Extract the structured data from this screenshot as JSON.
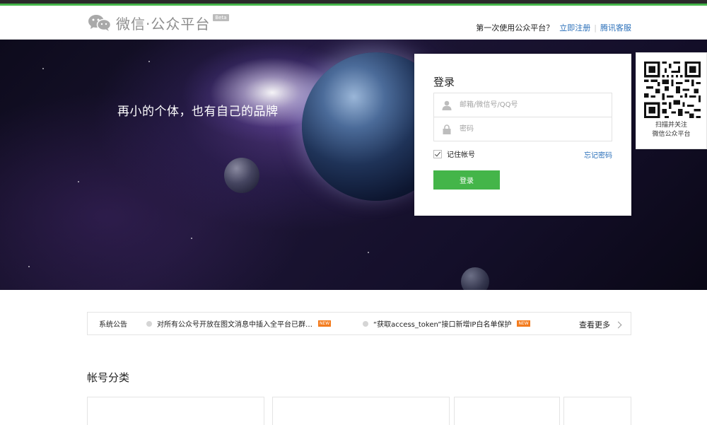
{
  "header": {
    "logo_text": "微信·公众平台",
    "logo_badge": "Beta",
    "question": "第一次使用公众平台？",
    "register_link": "立即注册",
    "separator": "|",
    "support_link": "腾讯客服"
  },
  "banner": {
    "slogan": "再小的个体，也有自己的品牌"
  },
  "login": {
    "title": "登录",
    "username_placeholder": "邮箱/微信号/QQ号",
    "password_placeholder": "密码",
    "remember_label": "记住帐号",
    "remember_checked": true,
    "forgot_link": "忘记密码",
    "submit_label": "登录"
  },
  "qr": {
    "caption_line1": "扫描并关注",
    "caption_line2": "微信公众平台"
  },
  "notice": {
    "label": "系统公告",
    "items": [
      {
        "text": "对所有公众号开放在图文消息中插入全平台已群…",
        "badge": "NEW"
      },
      {
        "text": "“获取access_token”接口新增IP白名单保护",
        "badge": "NEW"
      }
    ],
    "more_label": "查看更多"
  },
  "account_section": {
    "title": "帐号分类"
  },
  "colors": {
    "brand_green": "#44b549",
    "link_blue": "#2a6fb9",
    "badge_orange": "#f37b1d"
  }
}
